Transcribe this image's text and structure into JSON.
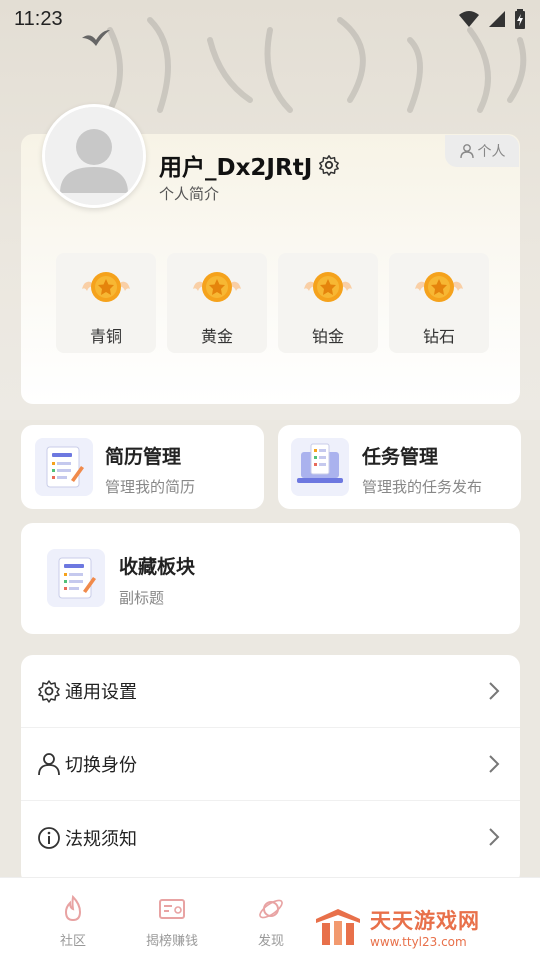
{
  "status_bar": {
    "time": "11:23"
  },
  "profile": {
    "username": "用户_Dx2JRtJ",
    "bio": "个人简介",
    "personal_tag": "个人",
    "levels": [
      {
        "label": "青铜"
      },
      {
        "label": "黄金"
      },
      {
        "label": "铂金"
      },
      {
        "label": "钻石"
      }
    ]
  },
  "cards": {
    "resume": {
      "title": "简历管理",
      "subtitle": "管理我的简历"
    },
    "tasks": {
      "title": "任务管理",
      "subtitle": "管理我的任务发布"
    },
    "favorites": {
      "title": "收藏板块",
      "subtitle": "副标题"
    }
  },
  "settings": [
    {
      "label": "通用设置",
      "icon": "gear-icon"
    },
    {
      "label": "切换身份",
      "icon": "user-icon"
    },
    {
      "label": "法规须知",
      "icon": "info-icon"
    }
  ],
  "bottom_nav": {
    "items": [
      {
        "label": "社区",
        "icon": "flame-icon"
      },
      {
        "label": "揭榜赚钱",
        "icon": "card-icon"
      },
      {
        "label": "发现",
        "icon": "planet-icon"
      }
    ]
  },
  "watermark": {
    "title": "天天游戏网",
    "url": "www.ttyl23.com"
  },
  "colors": {
    "accent": "#e8704a",
    "medal": "#f5a21c",
    "card_icon_bg": "#eef0fb"
  }
}
